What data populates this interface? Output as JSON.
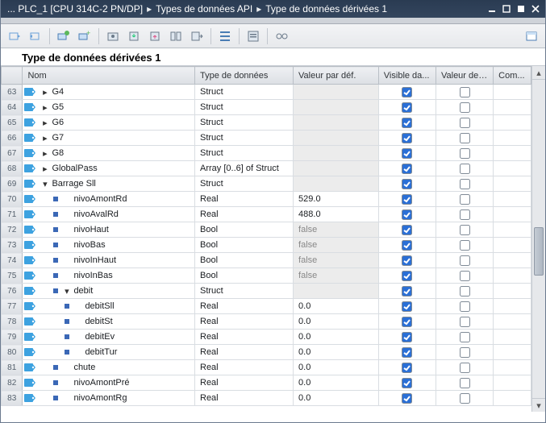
{
  "titlebar": {
    "crumb1": "... PLC_1 [CPU 314C-2 PN/DP]",
    "crumb2": "Types de données API",
    "crumb3": "Type de données dérivées 1"
  },
  "heading": "Type de données dérivées 1",
  "columns": {
    "name": "Nom",
    "dtype": "Type de données",
    "defval": "Valeur par déf.",
    "visible": "Visible da...",
    "setval": "Valeur de ...",
    "comment": "Com..."
  },
  "rows": [
    {
      "n": 63,
      "depth": 0,
      "exp": "closed",
      "sq": false,
      "name": "G4",
      "dtype": "Struct",
      "val": "",
      "gray": true,
      "vis": true,
      "set": false
    },
    {
      "n": 64,
      "depth": 0,
      "exp": "closed",
      "sq": false,
      "name": "G5",
      "dtype": "Struct",
      "val": "",
      "gray": true,
      "vis": true,
      "set": false
    },
    {
      "n": 65,
      "depth": 0,
      "exp": "closed",
      "sq": false,
      "name": "G6",
      "dtype": "Struct",
      "val": "",
      "gray": true,
      "vis": true,
      "set": false
    },
    {
      "n": 66,
      "depth": 0,
      "exp": "closed",
      "sq": false,
      "name": "G7",
      "dtype": "Struct",
      "val": "",
      "gray": true,
      "vis": true,
      "set": false
    },
    {
      "n": 67,
      "depth": 0,
      "exp": "closed",
      "sq": false,
      "name": "G8",
      "dtype": "Struct",
      "val": "",
      "gray": true,
      "vis": true,
      "set": false
    },
    {
      "n": 68,
      "depth": 0,
      "exp": "closed",
      "sq": false,
      "name": "GlobalPass",
      "dtype": "Array [0..6] of Struct",
      "val": "",
      "gray": true,
      "vis": true,
      "set": false
    },
    {
      "n": 69,
      "depth": 0,
      "exp": "open",
      "sq": false,
      "name": "Barrage Sll",
      "dtype": "Struct",
      "val": "",
      "gray": true,
      "vis": true,
      "set": false
    },
    {
      "n": 70,
      "depth": 1,
      "exp": "none",
      "sq": true,
      "name": "nivoAmontRd",
      "dtype": "Real",
      "val": "529.0",
      "gray": false,
      "vis": true,
      "set": false
    },
    {
      "n": 71,
      "depth": 1,
      "exp": "none",
      "sq": true,
      "name": "nivoAvalRd",
      "dtype": "Real",
      "val": "488.0",
      "gray": false,
      "vis": true,
      "set": false
    },
    {
      "n": 72,
      "depth": 1,
      "exp": "none",
      "sq": true,
      "name": "nivoHaut",
      "dtype": "Bool",
      "val": "false",
      "gray": true,
      "valtext": true,
      "vis": true,
      "set": false
    },
    {
      "n": 73,
      "depth": 1,
      "exp": "none",
      "sq": true,
      "name": "nivoBas",
      "dtype": "Bool",
      "val": "false",
      "gray": true,
      "valtext": true,
      "vis": true,
      "set": false
    },
    {
      "n": 74,
      "depth": 1,
      "exp": "none",
      "sq": true,
      "name": "nivoInHaut",
      "dtype": "Bool",
      "val": "false",
      "gray": true,
      "valtext": true,
      "vis": true,
      "set": false
    },
    {
      "n": 75,
      "depth": 1,
      "exp": "none",
      "sq": true,
      "name": "nivoInBas",
      "dtype": "Bool",
      "val": "false",
      "gray": true,
      "valtext": true,
      "vis": true,
      "set": false
    },
    {
      "n": 76,
      "depth": 1,
      "exp": "open",
      "sq": true,
      "name": "debit",
      "dtype": "Struct",
      "val": "",
      "gray": true,
      "vis": true,
      "set": false
    },
    {
      "n": 77,
      "depth": 2,
      "exp": "none",
      "sq": true,
      "name": "debitSll",
      "dtype": "Real",
      "val": "0.0",
      "gray": false,
      "vis": true,
      "set": false
    },
    {
      "n": 78,
      "depth": 2,
      "exp": "none",
      "sq": true,
      "name": "debitSt",
      "dtype": "Real",
      "val": "0.0",
      "gray": false,
      "vis": true,
      "set": false
    },
    {
      "n": 79,
      "depth": 2,
      "exp": "none",
      "sq": true,
      "name": "debitEv",
      "dtype": "Real",
      "val": "0.0",
      "gray": false,
      "vis": true,
      "set": false
    },
    {
      "n": 80,
      "depth": 2,
      "exp": "none",
      "sq": true,
      "name": "debitTur",
      "dtype": "Real",
      "val": "0.0",
      "gray": false,
      "vis": true,
      "set": false
    },
    {
      "n": 81,
      "depth": 1,
      "exp": "none",
      "sq": true,
      "name": "chute",
      "dtype": "Real",
      "val": "0.0",
      "gray": false,
      "vis": true,
      "set": false
    },
    {
      "n": 82,
      "depth": 1,
      "exp": "none",
      "sq": true,
      "name": "nivoAmontPré",
      "dtype": "Real",
      "val": "0.0",
      "gray": false,
      "vis": true,
      "set": false
    },
    {
      "n": 83,
      "depth": 1,
      "exp": "none",
      "sq": true,
      "name": "nivoAmontRg",
      "dtype": "Real",
      "val": "0.0",
      "gray": false,
      "vis": true,
      "set": false
    }
  ]
}
